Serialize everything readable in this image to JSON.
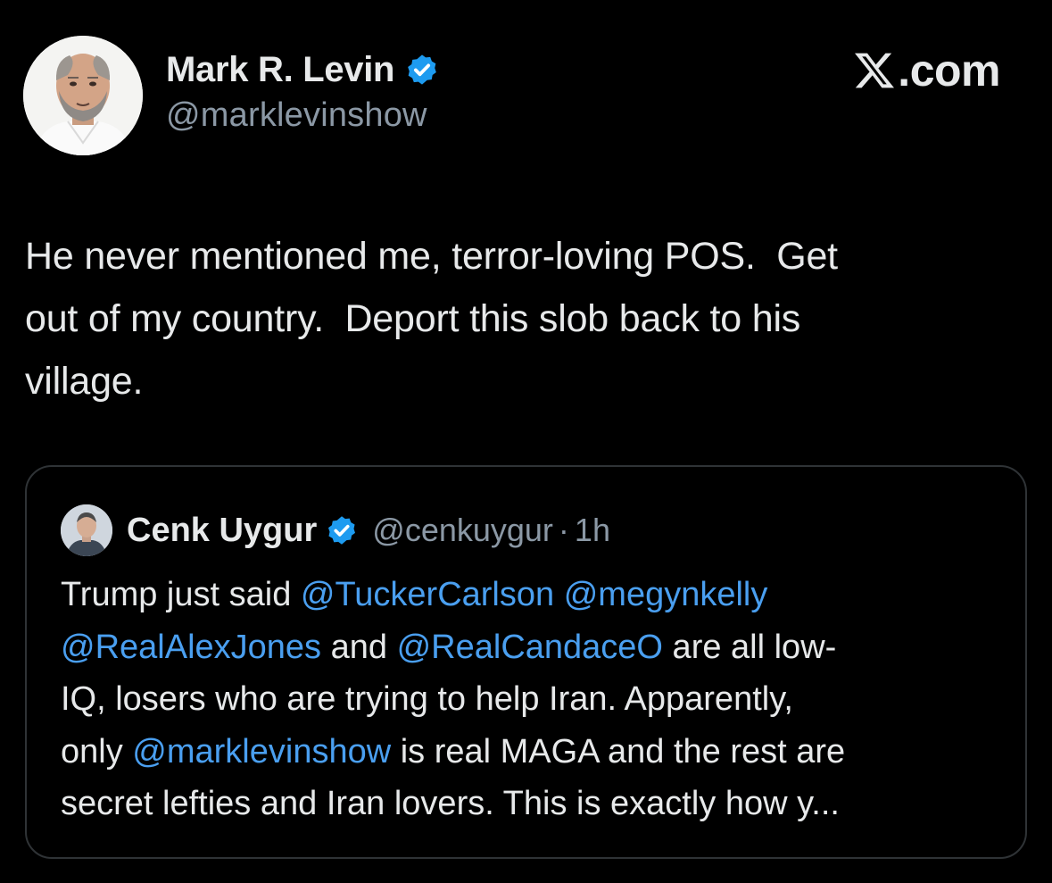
{
  "author": {
    "display_name": "Mark R. Levin",
    "handle": "@marklevinshow",
    "verified": true,
    "avatar_icon": "person-portrait-avatar"
  },
  "brand": {
    "logo_icon": "x-logo-icon",
    "text": ".com"
  },
  "tweet": {
    "text": "He never mentioned me, terror-loving POS.  Get\nout of my country.  Deport this slob back to his\nvillage."
  },
  "quoted_tweet": {
    "display_name": "Cenk Uygur",
    "handle": "@cenkuygur",
    "separator": "·",
    "time": "1h",
    "verified": true,
    "avatar_icon": "person-portrait-avatar",
    "segments": [
      {
        "text": "Trump just said ",
        "mention": false
      },
      {
        "text": "@TuckerCarlson",
        "mention": true
      },
      {
        "text": " ",
        "mention": false
      },
      {
        "text": "@megynkelly",
        "mention": true
      },
      {
        "text": "\n",
        "mention": false
      },
      {
        "text": "@RealAlexJones",
        "mention": true
      },
      {
        "text": " and ",
        "mention": false
      },
      {
        "text": "@RealCandaceO",
        "mention": true
      },
      {
        "text": " are all low-\nIQ, losers who are trying to help Iran. Apparently,\nonly ",
        "mention": false
      },
      {
        "text": "@marklevinshow",
        "mention": true
      },
      {
        "text": " is real MAGA and the rest are\nsecret lefties and Iran lovers. This is exactly how y...",
        "mention": false
      }
    ]
  },
  "colors": {
    "background": "#000000",
    "text": "#e7e9ea",
    "secondary_text": "#8b98a5",
    "mention": "#4a9ff0",
    "verified_badge": "#1d9bf0",
    "border": "#2f3336"
  }
}
